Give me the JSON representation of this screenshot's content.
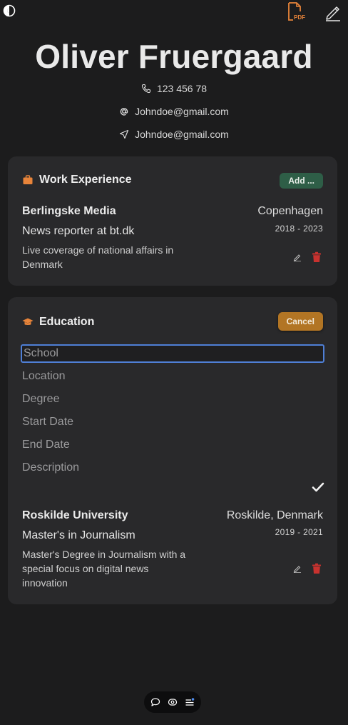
{
  "header": {
    "name": "Oliver Fruergaard",
    "pdf_label": "PDF",
    "phone": "123 456 78",
    "email": "Johndoe@gmail.com",
    "location_contact": "Johndoe@gmail.com"
  },
  "work": {
    "title": "Work Experience",
    "add_label": "Add ...",
    "entries": [
      {
        "company": "Berlingske Media",
        "location": "Copenhagen",
        "role": "News reporter at bt.dk",
        "dates": "2018 - 2023",
        "description": "Live coverage of national affairs in Denmark"
      }
    ]
  },
  "education": {
    "title": "Education",
    "cancel_label": "Cancel",
    "form": {
      "school_placeholder": "School",
      "location_placeholder": "Location",
      "degree_placeholder": "Degree",
      "start_placeholder": "Start Date",
      "end_placeholder": "End Date",
      "description_placeholder": "Description"
    },
    "entries": [
      {
        "school": "Roskilde University",
        "location": "Roskilde, Denmark",
        "degree": "Master's in Journalism",
        "dates": "2019 - 2021",
        "description": "Master's Degree in Journalism with a special focus on digital news innovation"
      }
    ]
  },
  "colors": {
    "accent_orange": "#e8843a",
    "add_green": "#2e5e47",
    "cancel_amber": "#b27524",
    "delete_red": "#c8322f",
    "focus_blue": "#4f7fd6"
  }
}
